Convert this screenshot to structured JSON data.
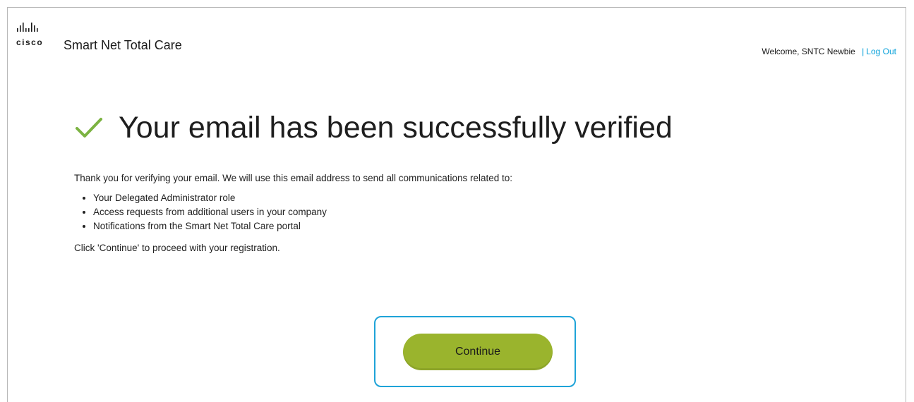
{
  "header": {
    "logo_word": "cisco",
    "app_title": "Smart Net Total Care",
    "welcome_text": "Welcome, SNTC Newbie",
    "separator": "|",
    "logout_label": "Log Out"
  },
  "main": {
    "heading": "Your email has been successfully verified",
    "intro": "Thank you for verifying your email. We will use this email address to send all communications related to:",
    "bullets": [
      "Your Delegated Administrator role",
      "Access requests from additional users in your company",
      "Notifications from the Smart Net Total Care portal"
    ],
    "instruction": "Click 'Continue' to proceed with your registration.",
    "continue_label": "Continue"
  },
  "icons": {
    "logo": "cisco-logo-icon",
    "check": "checkmark-icon"
  },
  "colors": {
    "accent_green": "#9ab42d",
    "check_green": "#7cb342",
    "link_blue": "#049fd9",
    "highlight_blue": "#1ea3d8"
  }
}
